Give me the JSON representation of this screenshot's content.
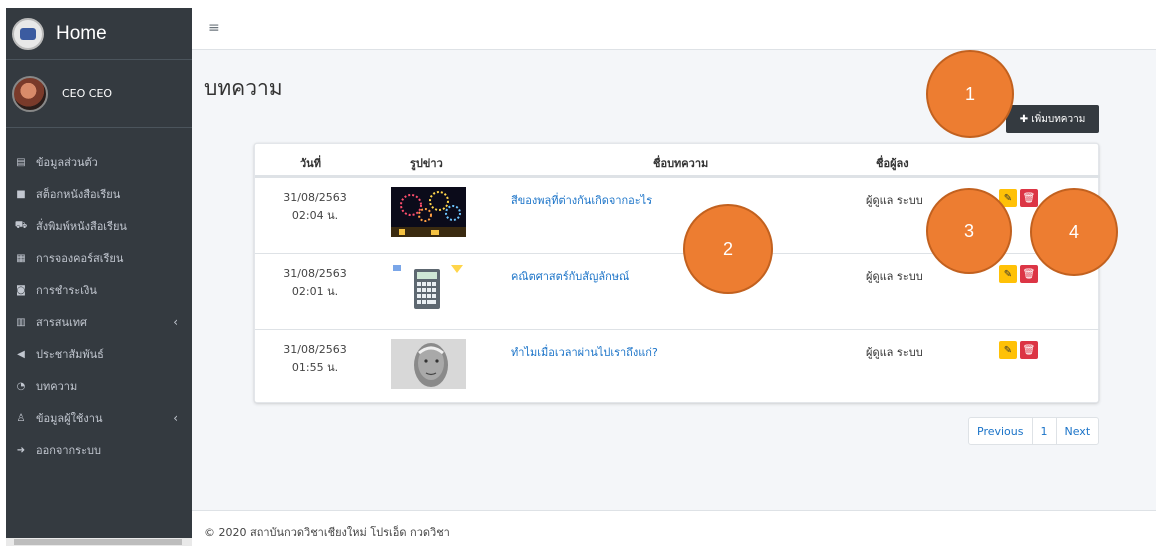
{
  "sidebar": {
    "brand": "Home",
    "user": "CEO CEO",
    "items": [
      {
        "label": "ข้อมูลส่วนตัว",
        "icon": "id-card-icon",
        "glyph": "▤"
      },
      {
        "label": "สต็อกหนังสือเรียน",
        "icon": "box-icon",
        "glyph": "■"
      },
      {
        "label": "สั่งพิมพ์หนังสือเรียน",
        "icon": "cart-icon",
        "glyph": "⛟"
      },
      {
        "label": "การจองคอร์สเรียน",
        "icon": "document-icon",
        "glyph": "▦"
      },
      {
        "label": "การชำระเงิน",
        "icon": "money-icon",
        "glyph": "◙"
      },
      {
        "label": "สารสนเทศ",
        "icon": "chart-icon",
        "glyph": "▥",
        "caret": "‹"
      },
      {
        "label": "ประชาสัมพันธ์",
        "icon": "megaphone-icon",
        "glyph": "◀"
      },
      {
        "label": "บทความ",
        "icon": "rss-icon",
        "glyph": "◔"
      },
      {
        "label": "ข้อมูลผู้ใช้งาน",
        "icon": "user-icon",
        "glyph": "♙",
        "caret": "‹"
      },
      {
        "label": "ออกจากระบบ",
        "icon": "sign-out-icon",
        "glyph": "➜"
      }
    ]
  },
  "topbar": {
    "menu_icon": "≡"
  },
  "page": {
    "title": "บทความ",
    "add_button": "✚ เพิ่มบทความ"
  },
  "table": {
    "headers": [
      "วันที่",
      "รูปข่าว",
      "ชื่อบทความ",
      "ชื่อผู้ลง"
    ],
    "rows": [
      {
        "date": "31/08/2563",
        "time": "02:04 น.",
        "title": "สีของพลุที่ต่างกันเกิดจากอะไร",
        "author": "ผู้ดูแล ระบบ",
        "image": "fireworks"
      },
      {
        "date": "31/08/2563",
        "time": "02:01 น.",
        "title": "คณิตศาสตร์กับสัญลักษณ์",
        "author": "ผู้ดูแล ระบบ",
        "image": "calculator"
      },
      {
        "date": "31/08/2563",
        "time": "01:55 น.",
        "title": "ทำไมเมื่อเวลาผ่านไปเราถึงแก่?",
        "author": "ผู้ดูแล ระบบ",
        "image": "old-man"
      }
    ],
    "edit_glyph": "✎",
    "delete_glyph": "🗑"
  },
  "pagination": {
    "prev": "Previous",
    "page": "1",
    "next": "Next"
  },
  "footer": "© 2020 สถาบันกวดวิชาเชียงใหม่ โปรเอ็ด กวดวิชา",
  "callouts": [
    "1",
    "2",
    "3",
    "4"
  ],
  "colors": {
    "sidebar": "#343a40",
    "callout": "#ed7d31",
    "edit": "#ffc107",
    "delete": "#dc3545",
    "link": "#1a73c8"
  }
}
